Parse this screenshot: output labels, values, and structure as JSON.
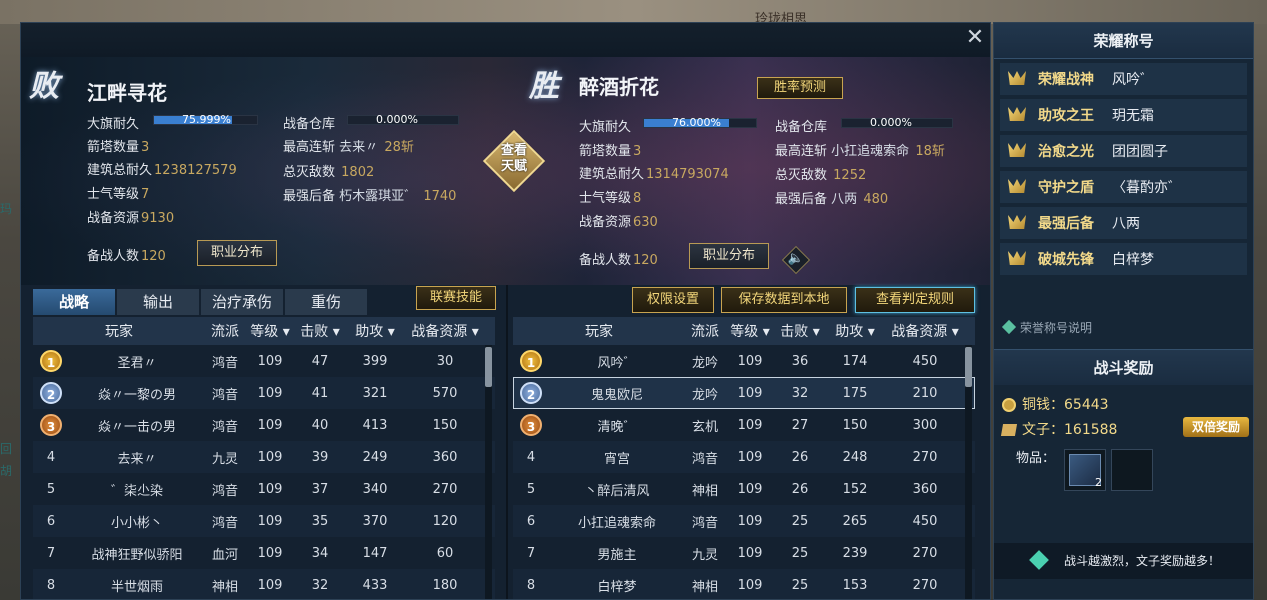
{
  "background": {
    "top_text": "玲珑相思",
    "left_text": [
      "玛",
      "回",
      "胡"
    ]
  },
  "losing_team": {
    "result": "败",
    "name": "江畔寻花",
    "banner_label": "大旗耐久",
    "banner_value": "75.999%",
    "banner_fraction": 0.76,
    "tower_label": "箭塔数量",
    "tower_value": "3",
    "build_label": "建筑总耐久",
    "build_value": "1238127579",
    "morale_label": "士气等级",
    "morale_value": "7",
    "res_label": "战备资源",
    "res_value": "9130",
    "warehouse_label": "战备仓库",
    "warehouse_value": "0.000%",
    "streak_label": "最高连斩",
    "streak_name": "去来〃",
    "streak_value": "28斩",
    "kills_label": "总灭敌数",
    "kills_value": "1802",
    "backup_label": "最强后备",
    "backup_name": "朽木露琪亚゛",
    "backup_value": "1740",
    "reserve_label": "备战人数",
    "reserve_value": "120",
    "dist_button": "职业分布"
  },
  "winning_team": {
    "result": "胜",
    "name": "醉酒折花",
    "predict_button": "胜率预测",
    "banner_label": "大旗耐久",
    "banner_value": "76.000%",
    "banner_fraction": 0.76,
    "tower_label": "箭塔数量",
    "tower_value": "3",
    "build_label": "建筑总耐久",
    "build_value": "1314793074",
    "morale_label": "士气等级",
    "morale_value": "8",
    "res_label": "战备资源",
    "res_value": "630",
    "warehouse_label": "战备仓库",
    "warehouse_value": "0.000%",
    "streak_label": "最高连斩",
    "streak_name": "小扛追魂索命",
    "streak_value": "18斩",
    "kills_label": "总灭敌数",
    "kills_value": "1252",
    "backup_label": "最强后备",
    "backup_name": "八两",
    "backup_value": "480",
    "reserve_label": "备战人数",
    "reserve_value": "120",
    "dist_button": "职业分布"
  },
  "talent_button": {
    "line1": "查看",
    "line2": "天赋"
  },
  "close_icon": "✕",
  "speaker_icon": "🔈",
  "tabs": [
    "战略",
    "输出",
    "治疗承伤",
    "重伤"
  ],
  "actions": {
    "league_skill": "联赛技能",
    "perm": "权限设置",
    "save": "保存数据到本地",
    "rules": "查看判定规则"
  },
  "columns": {
    "player": "玩家",
    "school": "流派",
    "level": "等级",
    "kills": "击败",
    "assists": "助攻",
    "resources": "战备资源"
  },
  "left_rows": [
    {
      "rank": "1",
      "name": "圣君〃",
      "school": "鸿音",
      "level": "109",
      "kills": "47",
      "assists": "399",
      "res": "30"
    },
    {
      "rank": "2",
      "name": "焱〃一黎の男",
      "school": "鸿音",
      "level": "109",
      "kills": "41",
      "assists": "321",
      "res": "570"
    },
    {
      "rank": "3",
      "name": "焱〃一击の男",
      "school": "鸿音",
      "level": "109",
      "kills": "40",
      "assists": "413",
      "res": "150"
    },
    {
      "rank": "4",
      "name": "去来〃",
      "school": "九灵",
      "level": "109",
      "kills": "39",
      "assists": "249",
      "res": "360"
    },
    {
      "rank": "5",
      "name": "゛柒尐染",
      "school": "鸿音",
      "level": "109",
      "kills": "37",
      "assists": "340",
      "res": "270"
    },
    {
      "rank": "6",
      "name": "小小彬丶",
      "school": "鸿音",
      "level": "109",
      "kills": "35",
      "assists": "370",
      "res": "120"
    },
    {
      "rank": "7",
      "name": "战神狂野似骄阳",
      "school": "血河",
      "level": "109",
      "kills": "34",
      "assists": "147",
      "res": "60"
    },
    {
      "rank": "8",
      "name": "半世烟雨",
      "school": "神相",
      "level": "109",
      "kills": "32",
      "assists": "433",
      "res": "180"
    }
  ],
  "right_rows": [
    {
      "rank": "1",
      "name": "风吟゛",
      "school": "龙吟",
      "level": "109",
      "kills": "36",
      "assists": "174",
      "res": "450"
    },
    {
      "rank": "2",
      "name": "鬼鬼欧尼",
      "school": "龙吟",
      "level": "109",
      "kills": "32",
      "assists": "175",
      "res": "210"
    },
    {
      "rank": "3",
      "name": "清晚゛",
      "school": "玄机",
      "level": "109",
      "kills": "27",
      "assists": "150",
      "res": "300"
    },
    {
      "rank": "4",
      "name": "宵宫",
      "school": "鸿音",
      "level": "109",
      "kills": "26",
      "assists": "248",
      "res": "270"
    },
    {
      "rank": "5",
      "name": "丶醉后清风",
      "school": "神相",
      "level": "109",
      "kills": "26",
      "assists": "152",
      "res": "360"
    },
    {
      "rank": "6",
      "name": "小扛追魂索命",
      "school": "鸿音",
      "level": "109",
      "kills": "25",
      "assists": "265",
      "res": "450"
    },
    {
      "rank": "7",
      "name": "男施主",
      "school": "九灵",
      "level": "109",
      "kills": "25",
      "assists": "239",
      "res": "270"
    },
    {
      "rank": "8",
      "name": "白梓梦",
      "school": "神相",
      "level": "109",
      "kills": "25",
      "assists": "153",
      "res": "270"
    }
  ],
  "honors": {
    "title": "荣耀称号",
    "items": [
      {
        "title": "荣耀战神",
        "name": "风吟゛"
      },
      {
        "title": "助攻之王",
        "name": "玥无霜"
      },
      {
        "title": "治愈之光",
        "name": "团团圆子"
      },
      {
        "title": "守护之盾",
        "name": "〈暮酌亦゛"
      },
      {
        "title": "最强后备",
        "name": "八两"
      },
      {
        "title": "破城先锋",
        "name": "白梓梦"
      }
    ],
    "note": "荣誉称号说明"
  },
  "rewards": {
    "title": "战斗奖励",
    "coin_label": "铜钱：",
    "coin_value": "65443",
    "wenzi_label": "文子：",
    "wenzi_value": "161588",
    "double_label": "双倍奖励",
    "items_label": "物品：",
    "item_count": "2",
    "tip": "战斗越激烈，文子奖励越多！"
  }
}
